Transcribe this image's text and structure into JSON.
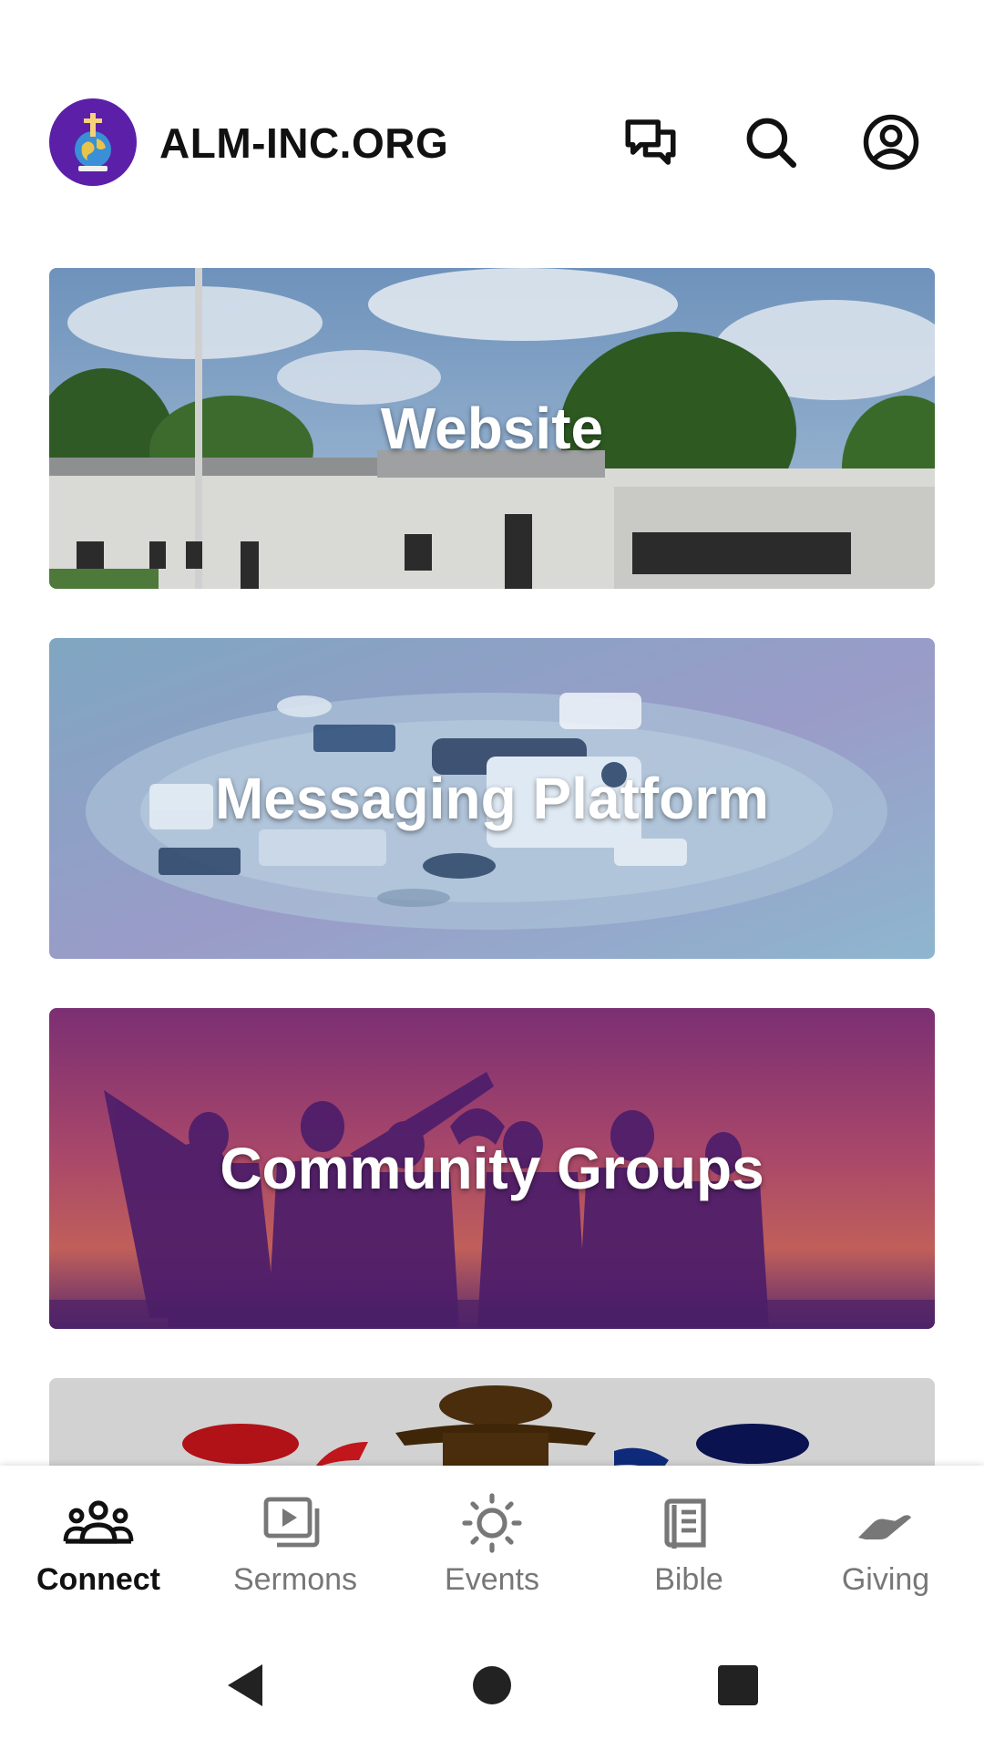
{
  "app": {
    "title": "ALM-INC.ORG",
    "brand_color": "#5b1fa8"
  },
  "header": {
    "icons": [
      "chat-icon",
      "search-icon",
      "account-icon"
    ]
  },
  "cards": [
    {
      "label": "Website",
      "image": "building-photo"
    },
    {
      "label": "Messaging Platform",
      "image": "messaging-illustration"
    },
    {
      "label": "Community Groups",
      "image": "group-silhouette-photo"
    },
    {
      "label": "",
      "image": "people-illustration"
    }
  ],
  "bottom_nav": {
    "active_index": 0,
    "items": [
      {
        "label": "Connect",
        "icon": "people-group-icon"
      },
      {
        "label": "Sermons",
        "icon": "video-library-icon"
      },
      {
        "label": "Events",
        "icon": "sun-icon"
      },
      {
        "label": "Bible",
        "icon": "book-icon"
      },
      {
        "label": "Giving",
        "icon": "giving-hand-icon"
      }
    ]
  },
  "colors": {
    "active_nav": "#111111",
    "inactive_nav": "#777777"
  }
}
